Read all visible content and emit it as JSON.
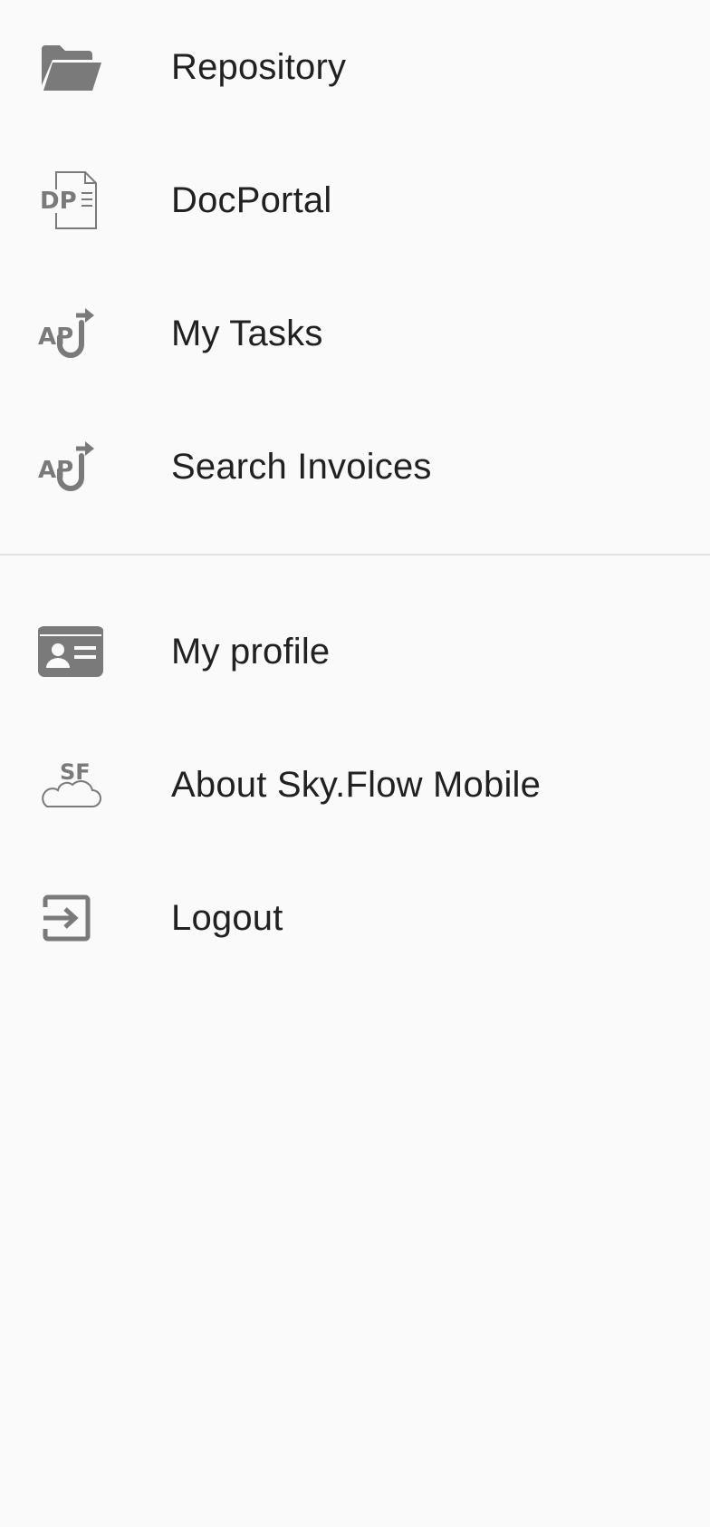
{
  "colors": {
    "background": "#fafafa",
    "text": "#212121",
    "icon": "#7a7a7a",
    "divider": "#e3e3e3"
  },
  "primary_items": [
    {
      "label": "Repository",
      "icon": "folder-open-icon"
    },
    {
      "label": "DocPortal",
      "icon": "docportal-icon"
    },
    {
      "label": "My Tasks",
      "icon": "ap-tasks-icon"
    },
    {
      "label": "Search Invoices",
      "icon": "ap-search-invoices-icon"
    }
  ],
  "secondary_items": [
    {
      "label": "My profile",
      "icon": "id-card-icon"
    },
    {
      "label": "About Sky.Flow Mobile",
      "icon": "skyflow-cloud-icon"
    },
    {
      "label": "Logout",
      "icon": "logout-icon"
    }
  ],
  "icon_text": {
    "docportal": "DP",
    "ap": "AP",
    "skyflow": "SF"
  }
}
